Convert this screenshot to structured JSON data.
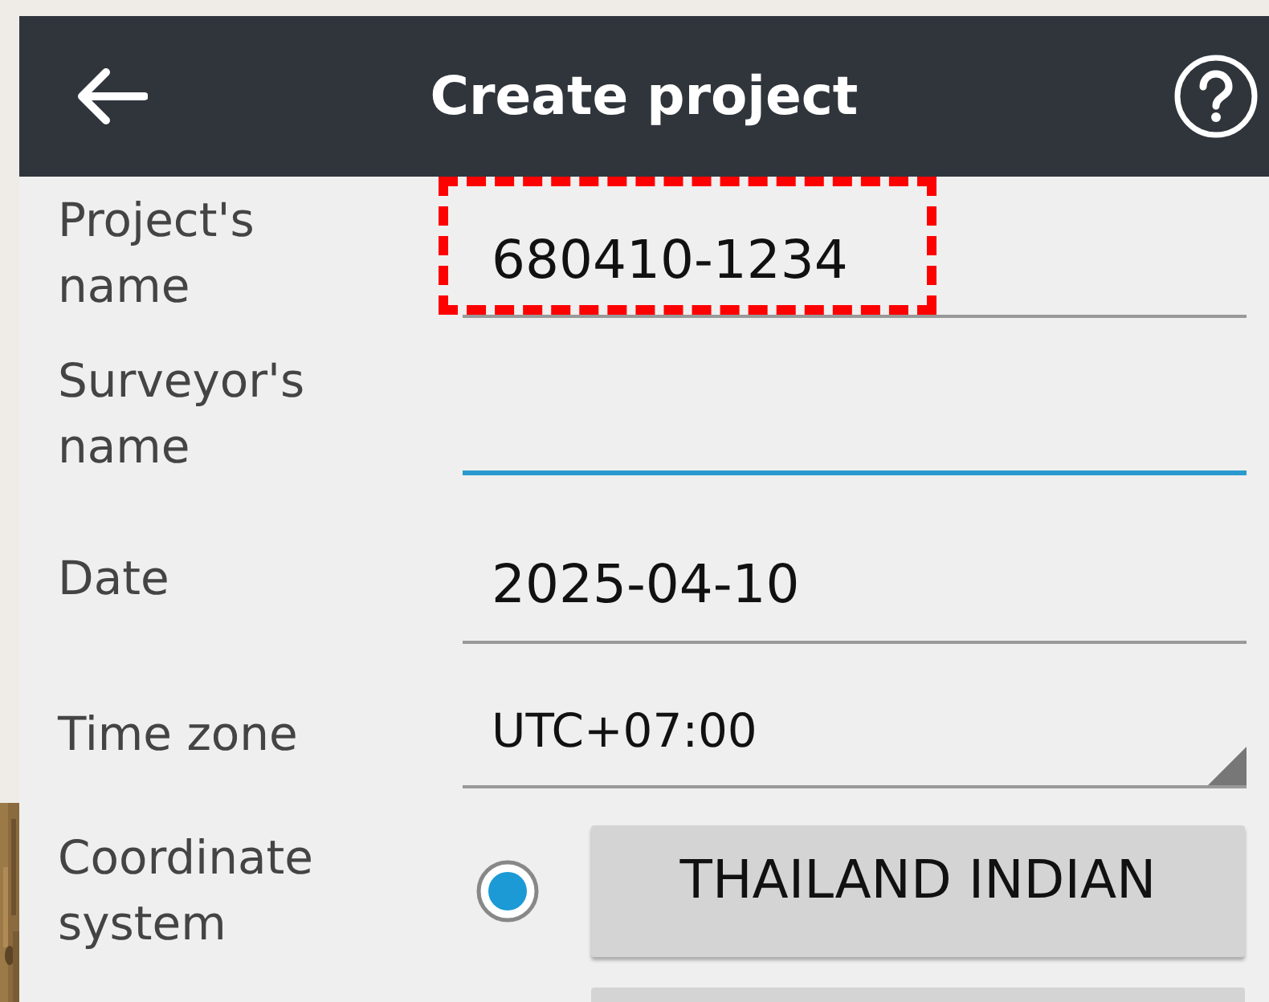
{
  "header": {
    "title": "Create project"
  },
  "fields": [
    {
      "kind": "text",
      "label": "Project's name",
      "value": "680410-1234",
      "focused": false,
      "highlighted": true
    },
    {
      "kind": "text",
      "label": "Surveyor's name",
      "focused": true,
      "highlighted": false
    },
    {
      "kind": "text",
      "label": "Date",
      "value": "2025-04-10",
      "focused": false,
      "highlighted": false
    },
    {
      "kind": "spinner",
      "label": "Time zone",
      "value": "UTC+07:00"
    },
    {
      "kind": "choice",
      "label": "Coordinate system",
      "selected": true,
      "value": "THAILAND INDIAN"
    }
  ]
}
